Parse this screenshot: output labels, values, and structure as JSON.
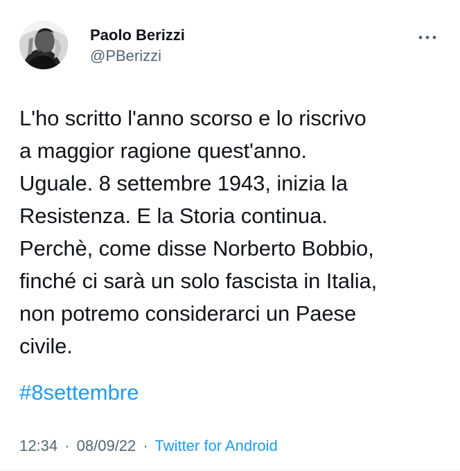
{
  "accent_color": "#1d9bf0",
  "secondary_text_color": "#536471",
  "author": {
    "display_name": "Paolo Berizzi",
    "handle": "@PBerizzi",
    "avatar_icon": "profile-photo"
  },
  "tweet": {
    "lines": [
      "L'ho scritto l'anno scorso e lo riscrivo",
      "a maggior ragione quest'anno.",
      "Uguale. 8 settembre 1943, inizia la",
      "Resistenza. E la Storia continua.",
      "Perchè, come disse Norberto Bobbio,",
      "finché ci sarà un solo fascista in Italia,",
      "non potremo considerarci un Paese",
      "civile."
    ],
    "hashtag": "#8settembre"
  },
  "meta": {
    "time": "12:34",
    "separator_1": "·",
    "date": "08/09/22",
    "separator_2": "·",
    "source": "Twitter for Android"
  },
  "actions": {
    "more_icon": "more-horizontal-icon"
  }
}
